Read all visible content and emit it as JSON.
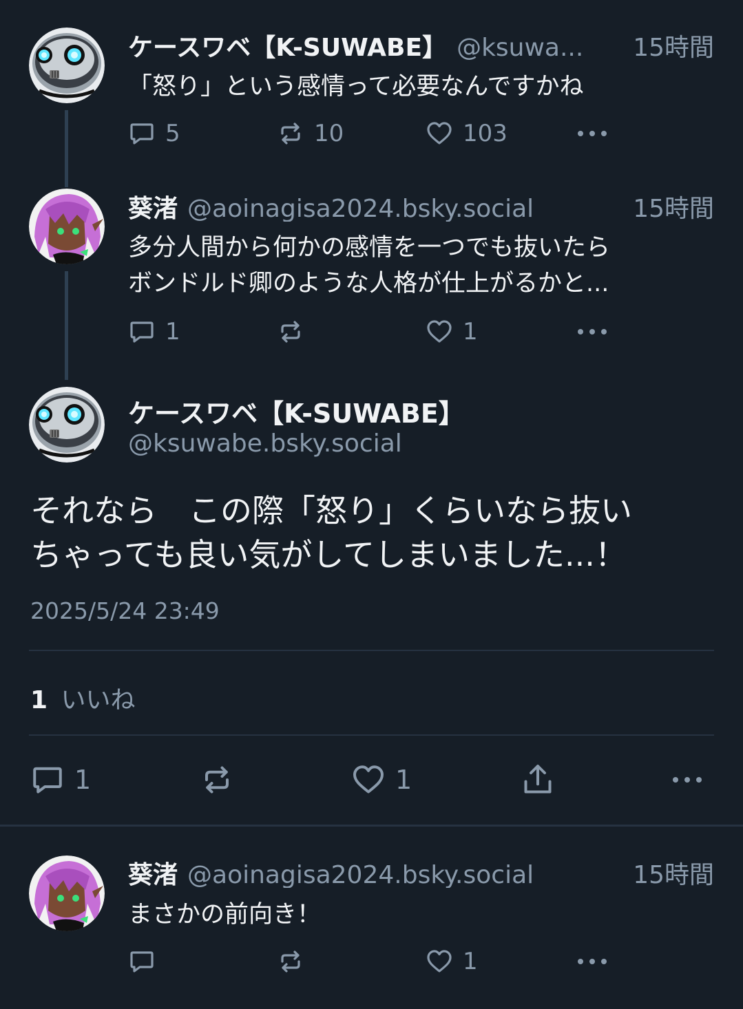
{
  "colors": {
    "background": "#161e27",
    "text": "#f1f3f5",
    "muted": "#8a9aab",
    "divider": "#263241"
  },
  "post1": {
    "name": "ケースワベ【K-SUWABE】",
    "handle": "@ksuwa...",
    "time": "15時間",
    "text": "「怒り」という感情って必要なんですかね",
    "replies": "5",
    "reposts": "10",
    "likes": "103"
  },
  "post2": {
    "name": "葵渚",
    "handle": "@aoinagisa2024.bsky.social",
    "time": "15時間",
    "text_line1": "多分人間から何かの感情を一つでも抜いたら",
    "text_line2": "ボンドルド卿のような人格が仕上がるかと...",
    "replies": "1",
    "reposts": "",
    "likes": "1"
  },
  "main": {
    "name": "ケースワベ【K-SUWABE】",
    "handle": "@ksuwabe.bsky.social",
    "text_line1": "それなら　この際「怒り」くらいなら抜い",
    "text_line2": "ちゃっても良い気がしてしまいました...！",
    "timestamp": "2025/5/24 23:49",
    "like_count": "1",
    "like_label": "いいね",
    "replies": "1",
    "reposts": "",
    "likes": "1"
  },
  "reply": {
    "name": "葵渚",
    "handle": "@aoinagisa2024.bsky.social",
    "time": "15時間",
    "text": "まさかの前向き！",
    "replies": "",
    "reposts": "",
    "likes": "1"
  },
  "icons": {
    "reply": "speech-bubble-icon",
    "repost": "repost-icon",
    "like": "heart-icon",
    "share": "share-icon",
    "more": "more-dots-icon"
  }
}
